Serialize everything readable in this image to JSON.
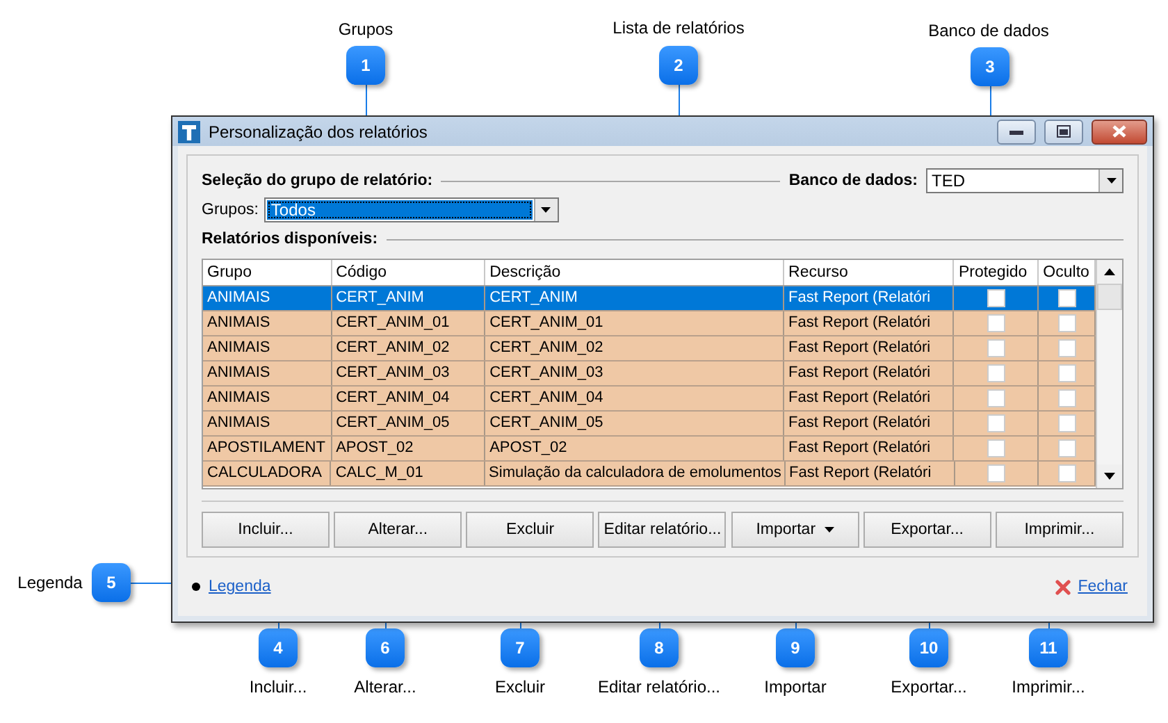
{
  "callouts": [
    {
      "number": "1",
      "label": "Grupos"
    },
    {
      "number": "2",
      "label": "Lista de relatórios"
    },
    {
      "number": "3",
      "label": "Banco de dados"
    },
    {
      "number": "4",
      "label": "Incluir..."
    },
    {
      "number": "5",
      "label": "Legenda"
    },
    {
      "number": "6",
      "label": "Alterar..."
    },
    {
      "number": "7",
      "label": "Excluir"
    },
    {
      "number": "8",
      "label": "Editar relatório..."
    },
    {
      "number": "9",
      "label": "Importar"
    },
    {
      "number": "10",
      "label": "Exportar..."
    },
    {
      "number": "11",
      "label": "Imprimir..."
    }
  ],
  "window": {
    "title": "Personalização dos relatórios"
  },
  "selection": {
    "heading": "Seleção do grupo de relatório:",
    "groups_label": "Grupos:",
    "groups_value": "Todos",
    "database_label": "Banco de dados:",
    "database_value": "TED"
  },
  "reports": {
    "heading": "Relatórios disponíveis:",
    "columns": [
      "Grupo",
      "Código",
      "Descrição",
      "Recurso",
      "Protegido",
      "Oculto"
    ],
    "rows": [
      {
        "group": "ANIMAIS",
        "code": "CERT_ANIM",
        "description": "CERT_ANIM",
        "resource": "Fast Report (Relatóri",
        "protected": false,
        "hidden": false,
        "selected": true
      },
      {
        "group": "ANIMAIS",
        "code": "CERT_ANIM_01",
        "description": "CERT_ANIM_01",
        "resource": "Fast Report (Relatóri",
        "protected": false,
        "hidden": false,
        "selected": false
      },
      {
        "group": "ANIMAIS",
        "code": "CERT_ANIM_02",
        "description": "CERT_ANIM_02",
        "resource": "Fast Report (Relatóri",
        "protected": false,
        "hidden": false,
        "selected": false
      },
      {
        "group": "ANIMAIS",
        "code": "CERT_ANIM_03",
        "description": "CERT_ANIM_03",
        "resource": "Fast Report (Relatóri",
        "protected": false,
        "hidden": false,
        "selected": false
      },
      {
        "group": "ANIMAIS",
        "code": "CERT_ANIM_04",
        "description": "CERT_ANIM_04",
        "resource": "Fast Report (Relatóri",
        "protected": false,
        "hidden": false,
        "selected": false
      },
      {
        "group": "ANIMAIS",
        "code": "CERT_ANIM_05",
        "description": "CERT_ANIM_05",
        "resource": "Fast Report (Relatóri",
        "protected": false,
        "hidden": false,
        "selected": false
      },
      {
        "group": "APOSTILAMENT",
        "code": "APOST_02",
        "description": "APOST_02",
        "resource": "Fast Report (Relatóri",
        "protected": false,
        "hidden": false,
        "selected": false
      },
      {
        "group": "CALCULADORA",
        "code": "CALC_M_01",
        "description": "Simulação da calculadora de emolumentos",
        "resource": "Fast Report (Relatóri",
        "protected": false,
        "hidden": false,
        "selected": false
      }
    ]
  },
  "buttons": [
    {
      "label": "Incluir...",
      "kind": "plain"
    },
    {
      "label": "Alterar...",
      "kind": "plain"
    },
    {
      "label": "Excluir",
      "kind": "plain"
    },
    {
      "label": "Editar relatório...",
      "kind": "plain"
    },
    {
      "label": "Importar",
      "kind": "dropdown"
    },
    {
      "label": "Exportar...",
      "kind": "plain"
    },
    {
      "label": "Imprimir...",
      "kind": "plain"
    }
  ],
  "legend_link": "Legenda",
  "close_link": "Fechar"
}
